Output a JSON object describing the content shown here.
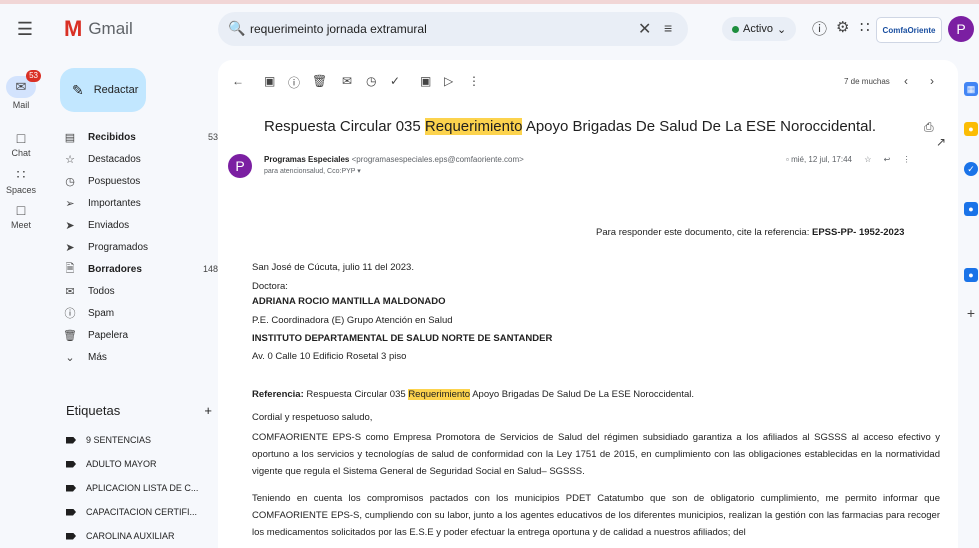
{
  "app": {
    "name": "Gmail"
  },
  "search": {
    "query": "requerimeinto jornada extramural"
  },
  "header": {
    "status_label": "Activo",
    "brand_label": "ComfaOriente",
    "avatar_letter": "P"
  },
  "rail": {
    "items": [
      {
        "label": "Mail",
        "badge": "53"
      },
      {
        "label": "Chat"
      },
      {
        "label": "Spaces"
      },
      {
        "label": "Meet"
      }
    ]
  },
  "compose": {
    "label": "Redactar"
  },
  "nav": {
    "items": [
      {
        "label": "Recibidos",
        "count": "53",
        "bold": true
      },
      {
        "label": "Destacados",
        "count": ""
      },
      {
        "label": "Pospuestos",
        "count": ""
      },
      {
        "label": "Importantes",
        "count": ""
      },
      {
        "label": "Enviados",
        "count": ""
      },
      {
        "label": "Programados",
        "count": ""
      },
      {
        "label": "Borradores",
        "count": "148",
        "bold": true
      },
      {
        "label": "Todos",
        "count": ""
      },
      {
        "label": "Spam",
        "count": ""
      },
      {
        "label": "Papelera",
        "count": ""
      },
      {
        "label": "Más",
        "count": ""
      }
    ]
  },
  "labels": {
    "title": "Etiquetas",
    "items": [
      "9 SENTENCIAS",
      "ADULTO MAYOR",
      "APLICACION LISTA DE C...",
      "CAPACITACION CERTIFI...",
      "CAROLINA AUXILIAR"
    ]
  },
  "toolbar": {
    "count": "7 de muchas"
  },
  "email": {
    "subject_pre": "Respuesta Circular 035 ",
    "subject_hl": "Requerimiento",
    "subject_post": " Apoyo Brigadas De Salud De La ESE Noroccidental.",
    "sender_name": "Programas Especiales",
    "sender_email": "<programasespeciales.eps@comfaoriente.com>",
    "recipient": "para atencionsalud, Cco:PYP",
    "date": "mié, 12 jul, 17:44",
    "reference_top_pre": "Para responder este documento, cite la referencia: ",
    "reference_top_code": "EPSS-PP- 1952-2023",
    "place_date": "San José de Cúcuta, julio 11 del 2023.",
    "salutation_title": "Doctora:",
    "recipient_name": "ADRIANA ROCIO MANTILLA MALDONADO",
    "recipient_role": "P.E. Coordinadora (E) Grupo Atención en Salud",
    "institution": "INSTITUTO DEPARTAMENTAL DE SALUD NORTE DE SANTANDER",
    "address": "Av. 0 Calle 10 Edificio Rosetal 3 piso",
    "ref_label": "Referencia:",
    "ref_pre": " Respuesta Circular 035 ",
    "ref_hl": "Requerimiento",
    "ref_post": " Apoyo Brigadas De Salud De La ESE Noroccidental.",
    "greeting": "Cordial y respetuoso saludo,",
    "para1": "COMFAORIENTE EPS-S como Empresa Promotora de Servicios de Salud del régimen subsidiado garantiza a los afiliados al SGSSS al acceso efectivo y oportuno a los servicios y tecnologías de salud de conformidad con la Ley 1751 de 2015, en cumplimiento con las obligaciones establecidas en la normatividad vigente que regula el Sistema General de Seguridad Social en Salud– SGSSS.",
    "para2": "Teniendo en cuenta los compromisos pactados con los municipios PDET Catatumbo que son de obligatorio cumplimiento, me permito informar que COMFAORIENTE EPS-S, cumpliendo con su labor, junto a los agentes educativos de los diferentes municipios, realizan la gestión con las farmacias para recoger los medicamentos solicitados por las E.S.E y poder efectuar la entrega oportuna y de calidad a nuestros afiliados; del"
  }
}
